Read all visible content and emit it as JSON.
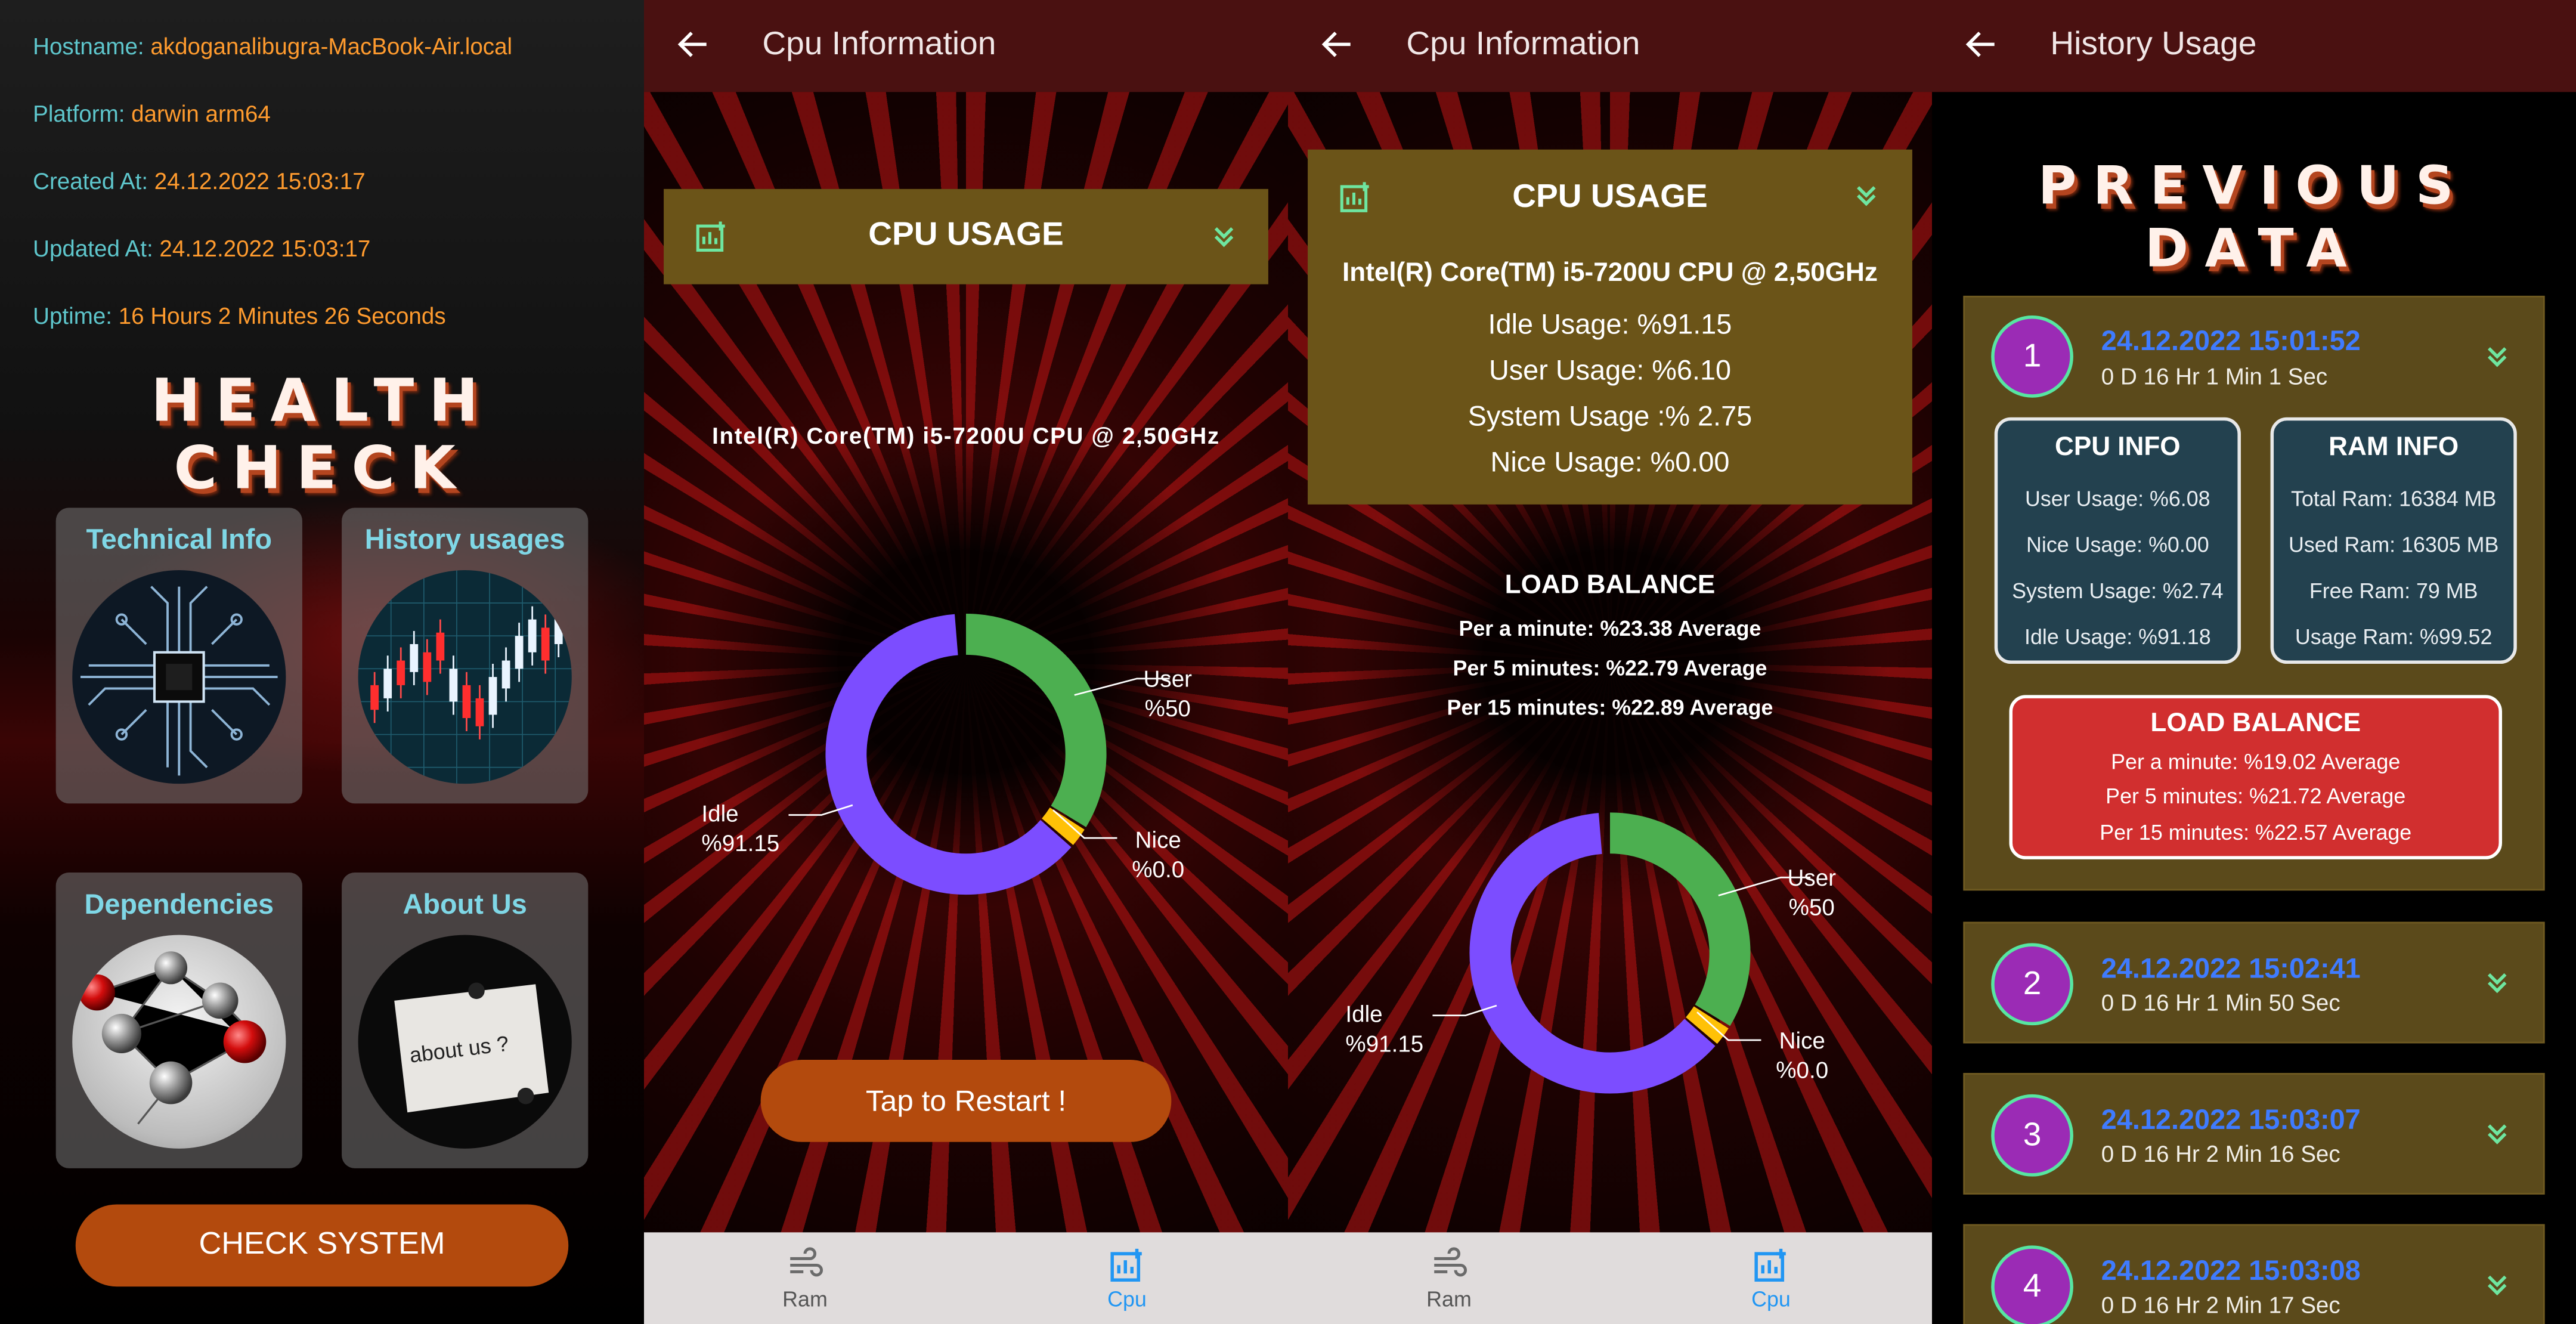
{
  "colors": {
    "appbar": "#4a1111",
    "gold_card": "#6b5418",
    "accent_orange": "#b34a0d",
    "donut_user": "#4caf50",
    "donut_idle": "#7c4dff",
    "donut_nice": "#ffc107",
    "nav_active": "#2196f3",
    "hist_date": "#3f7bff",
    "badge": "#9b2bb5"
  },
  "home": {
    "info": [
      {
        "key": "Hostname:",
        "value": "akdoganalibugra-MacBook-Air.local"
      },
      {
        "key": "Platform:",
        "value": "darwin arm64"
      },
      {
        "key": "Created At:",
        "value": "24.12.2022 15:03:17"
      },
      {
        "key": "Updated At:",
        "value": "24.12.2022 15:03:17"
      },
      {
        "key": "Uptime:",
        "value": "16 Hours 2 Minutes 26 Seconds"
      }
    ],
    "title": "HEALTH CHECK",
    "tiles": [
      {
        "label": "Technical Info",
        "icon": "circuit-chip-icon"
      },
      {
        "label": "History usages",
        "icon": "candlestick-chart-icon"
      },
      {
        "label": "Dependencies",
        "icon": "network-spheres-icon"
      },
      {
        "label": "About Us",
        "icon": "note-pin-icon",
        "note_text": "about us ?"
      }
    ],
    "check_button": "CHECK SYSTEM"
  },
  "cpu1": {
    "title": "Cpu Information",
    "card_title": "CPU USAGE",
    "cpu_model": "Intel(R) Core(TM) i5-7200U CPU @ 2,50GHz",
    "labels": {
      "user": "User",
      "user_val": "%50",
      "idle": "Idle",
      "idle_val": "%91.15",
      "nice": "Nice",
      "nice_val": "%0.0"
    },
    "restart_button": "Tap to Restart !",
    "nav": {
      "ram": "Ram",
      "cpu": "Cpu"
    }
  },
  "cpu2": {
    "title": "Cpu Information",
    "card_title": "CPU USAGE",
    "cpu_model": "Intel(R) Core(TM) i5-7200U CPU @ 2,50GHz",
    "idle": "Idle Usage: %91.15",
    "user": "User Usage: %6.10",
    "system": "System Usage :% 2.75",
    "nice": "Nice Usage: %0.00",
    "lb_title": "LOAD BALANCE",
    "lb": [
      "Per a minute: %23.38 Average",
      "Per 5 minutes: %22.79 Average",
      "Per 15 minutes: %22.89 Average"
    ],
    "labels": {
      "user": "User",
      "user_val": "%50",
      "idle": "Idle",
      "idle_val": "%91.15",
      "nice": "Nice",
      "nice_val": "%0.0"
    },
    "nav": {
      "ram": "Ram",
      "cpu": "Cpu"
    }
  },
  "donut_fractions": {
    "user": 0.34,
    "nice": 0.025,
    "idle": 0.625
  },
  "history": {
    "title": "History Usage",
    "heading": "PREVIOUS DATA",
    "items": [
      {
        "n": "1",
        "date": "24.12.2022 15:01:52",
        "uptime": "0 D 16 Hr 1 Min 1 Sec"
      },
      {
        "n": "2",
        "date": "24.12.2022 15:02:41",
        "uptime": "0 D 16 Hr 1 Min 50 Sec"
      },
      {
        "n": "3",
        "date": "24.12.2022 15:03:07",
        "uptime": "0 D 16 Hr 2 Min 16 Sec"
      },
      {
        "n": "4",
        "date": "24.12.2022 15:03:08",
        "uptime": "0 D 16 Hr 2 Min 17 Sec"
      }
    ],
    "cpu_info": {
      "title": "CPU INFO",
      "rows": [
        "User Usage: %6.08",
        "Nice Usage: %0.00",
        "System Usage: %2.74",
        "Idle Usage: %91.18"
      ]
    },
    "ram_info": {
      "title": "RAM INFO",
      "rows": [
        "Total Ram: 16384 MB",
        "Used Ram: 16305 MB",
        "Free Ram: 79 MB",
        "Usage Ram: %99.52"
      ]
    },
    "load_balance": {
      "title": "LOAD BALANCE",
      "rows": [
        "Per a minute: %19.02 Average",
        "Per 5 minutes: %21.72 Average",
        "Per 15 minutes: %22.57 Average"
      ]
    }
  }
}
